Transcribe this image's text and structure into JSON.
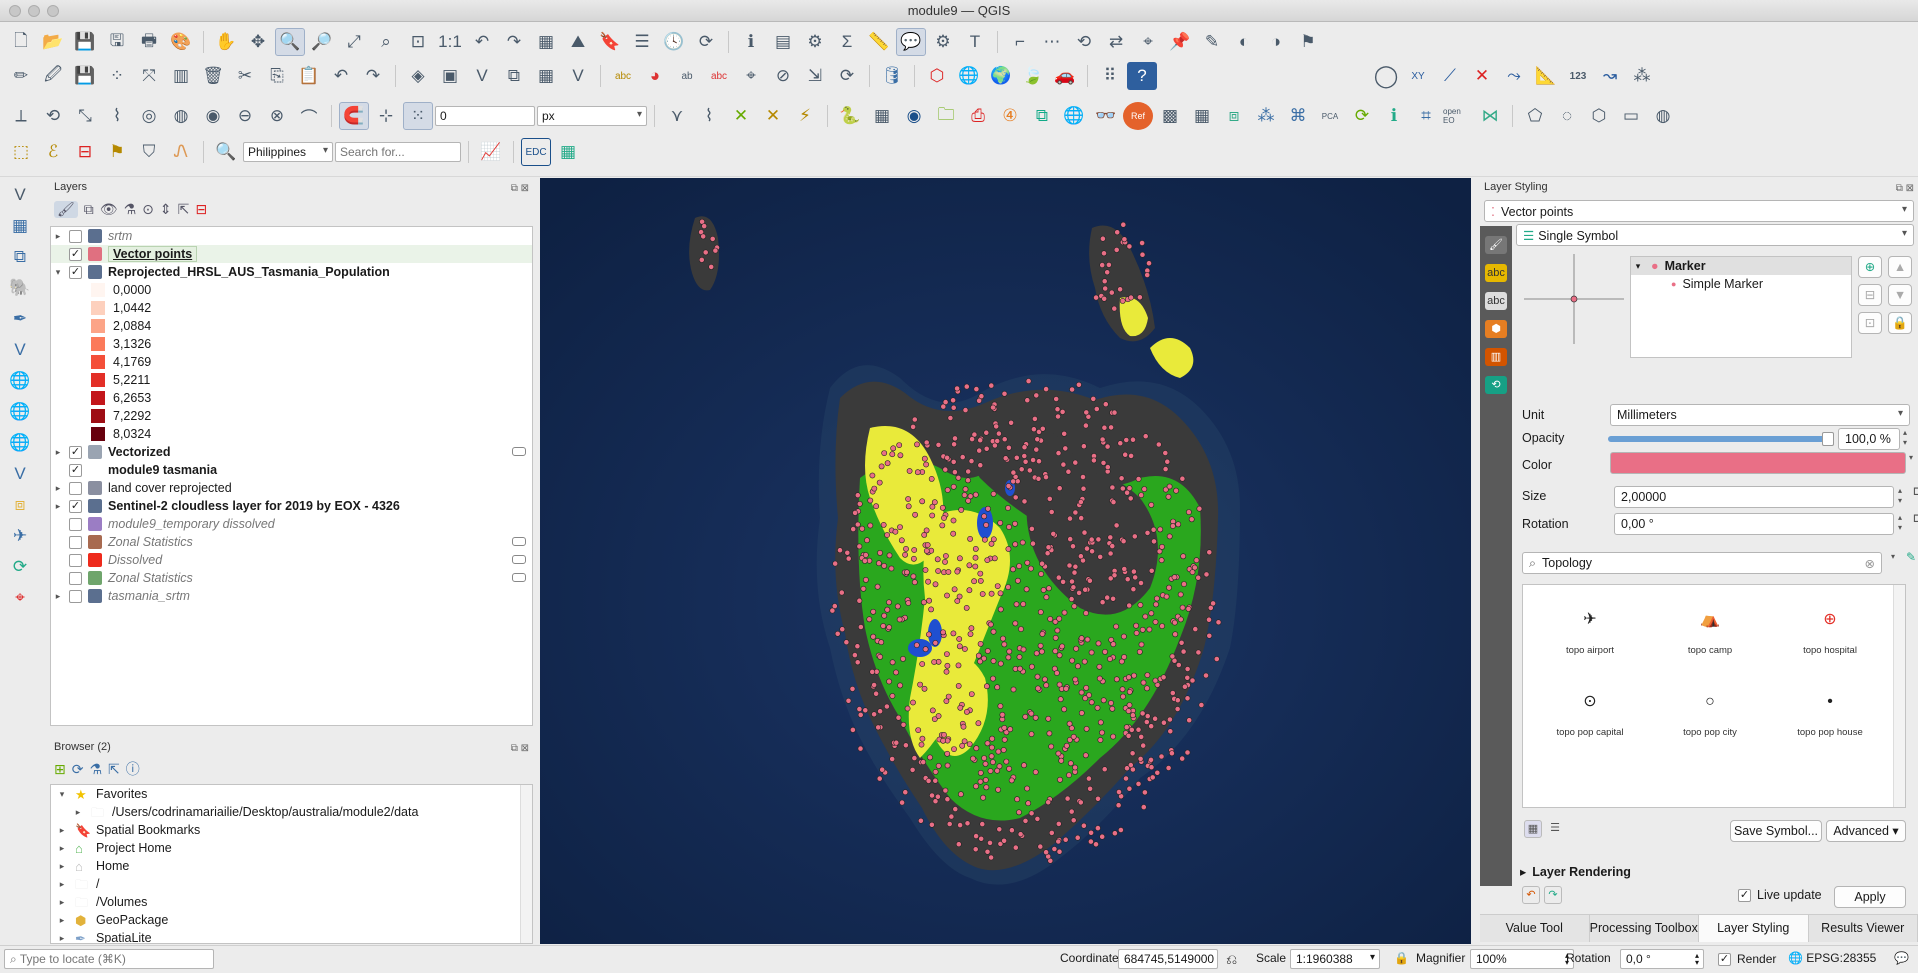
{
  "window": {
    "title": "module9 — QGIS"
  },
  "toolbar": {
    "snap_value": "0",
    "snap_unit": "px",
    "locator_country": "Philippines",
    "search_placeholder": "Search for...",
    "edc_label": "EDC",
    "xy_label": "XY",
    "label_123": "123",
    "open_eo_label": "open EO",
    "pca_label": "PCA",
    "ref_label": "Ref"
  },
  "layers_panel": {
    "title": "Layers",
    "layers": [
      {
        "name": "srtm",
        "style": "italic",
        "checked": false,
        "expand": "▸",
        "icon_color": "#5b6f8f"
      },
      {
        "name": "Vector points",
        "style": "sel",
        "checked": true,
        "expand": "",
        "icon_color": "#e07080"
      },
      {
        "name": "Reprojected_HRSL_AUS_Tasmania_Population",
        "style": "bold",
        "checked": true,
        "expand": "▾",
        "icon_color": "#5b6f8f"
      }
    ],
    "legend": [
      {
        "value": "0,0000",
        "color": "#fff5f0"
      },
      {
        "value": "1,0442",
        "color": "#fdd0bd"
      },
      {
        "value": "2,0884",
        "color": "#fca487"
      },
      {
        "value": "3,1326",
        "color": "#fb7a5a"
      },
      {
        "value": "4,1769",
        "color": "#f44f39"
      },
      {
        "value": "5,2211",
        "color": "#e32f27"
      },
      {
        "value": "6,2653",
        "color": "#c3161b"
      },
      {
        "value": "7,2292",
        "color": "#9e0d14"
      },
      {
        "value": "8,0324",
        "color": "#67000d"
      }
    ],
    "layers_after": [
      {
        "name": "Vectorized",
        "style": "bold",
        "checked": true,
        "expand": "▸",
        "icon_color": "#9aa4b2",
        "filter": true
      },
      {
        "name": "module9 tasmania",
        "style": "bold",
        "checked": true,
        "expand": "",
        "icon_color": "#ffffff"
      },
      {
        "name": "land cover reprojected",
        "style": "normal",
        "checked": false,
        "expand": "▸",
        "icon_color": "#8a8fa0"
      },
      {
        "name": "Sentinel-2 cloudless layer for 2019 by EOX - 4326",
        "style": "bold",
        "checked": true,
        "expand": "▸",
        "icon_color": "#5b6f8f"
      },
      {
        "name": "module9_temporary dissolved",
        "style": "italic",
        "checked": false,
        "expand": "",
        "icon_color": "#9b7dc4"
      },
      {
        "name": "Zonal Statistics",
        "style": "italic",
        "checked": false,
        "expand": "",
        "icon_color": "#a86a50",
        "filter": true
      },
      {
        "name": "Dissolved",
        "style": "italic",
        "checked": false,
        "expand": "",
        "icon_color": "#ee2a1c",
        "filter": true
      },
      {
        "name": "Zonal Statistics",
        "style": "italic",
        "checked": false,
        "expand": "",
        "icon_color": "#6fa56c",
        "filter": true
      },
      {
        "name": "tasmania_srtm",
        "style": "italic",
        "checked": false,
        "expand": "▸",
        "icon_color": "#5b6f8f"
      }
    ]
  },
  "browser_panel": {
    "title": "Browser (2)",
    "items": [
      {
        "label": "Favorites",
        "expand": "▾",
        "indent": 0,
        "icon": "star-icon",
        "color": "#f2c300"
      },
      {
        "label": "/Users/codrinamariailie/Desktop/australia/module2/data",
        "expand": "▸",
        "indent": 1,
        "icon": "folder-icon",
        "color": "#e8e8e8"
      },
      {
        "label": "Spatial Bookmarks",
        "expand": "▸",
        "indent": 0,
        "icon": "bookmark-icon",
        "color": "#6a8cc0"
      },
      {
        "label": "Project Home",
        "expand": "▸",
        "indent": 0,
        "icon": "home-icon",
        "color": "#5cb85c"
      },
      {
        "label": "Home",
        "expand": "▸",
        "indent": 0,
        "icon": "home-icon",
        "color": "#bbbbbb"
      },
      {
        "label": "/",
        "expand": "▸",
        "indent": 0,
        "icon": "folder-icon",
        "color": "#e8e8e8"
      },
      {
        "label": "/Volumes",
        "expand": "▸",
        "indent": 0,
        "icon": "folder-icon",
        "color": "#e8e8e8"
      },
      {
        "label": "GeoPackage",
        "expand": "▸",
        "indent": 0,
        "icon": "geopackage-icon",
        "color": "#e2b23b"
      },
      {
        "label": "SpatiaLite",
        "expand": "▸",
        "indent": 0,
        "icon": "spatialite-icon",
        "color": "#7da0c8"
      }
    ]
  },
  "layer_styling": {
    "title": "Layer Styling",
    "layer": "Vector points",
    "renderer": "Single Symbol",
    "tree": {
      "marker": "Marker",
      "simple_marker": "Simple Marker"
    },
    "unit_label": "Unit",
    "unit_value": "Millimeters",
    "opacity_label": "Opacity",
    "opacity_value": "100,0 %",
    "opacity_fraction": 1.0,
    "color_label": "Color",
    "color_value": "#e96f86",
    "size_label": "Size",
    "size_value": "2,00000",
    "rotation_label": "Rotation",
    "rotation_value": "0,00 °",
    "search_value": "Topology",
    "symbols": [
      {
        "label": "topo airport",
        "glyph": "✈"
      },
      {
        "label": "topo camp",
        "glyph": "⛺"
      },
      {
        "label": "topo hospital",
        "glyph": "⊕"
      },
      {
        "label": "topo pop capital",
        "glyph": "⊙"
      },
      {
        "label": "topo pop city",
        "glyph": "○"
      },
      {
        "label": "topo pop house",
        "glyph": "•"
      }
    ],
    "save_symbol": "Save Symbol...",
    "advanced": "Advanced",
    "layer_rendering": "Layer Rendering",
    "live_update": "Live update",
    "apply": "Apply",
    "tabs": [
      "Value Tool",
      "Processing Toolbox",
      "Layer Styling",
      "Results Viewer"
    ],
    "active_tab": 2
  },
  "statusbar": {
    "locate_placeholder": "Type to locate (⌘K)",
    "coordinate_label": "Coordinate",
    "coordinate_value": "684745,5149000",
    "scale_label": "Scale",
    "scale_value": "1:1960388",
    "magnifier_label": "Magnifier",
    "magnifier_value": "100%",
    "rotation_label": "Rotation",
    "rotation_value": "0,0 °",
    "render_label": "Render",
    "crs": "EPSG:28355"
  }
}
